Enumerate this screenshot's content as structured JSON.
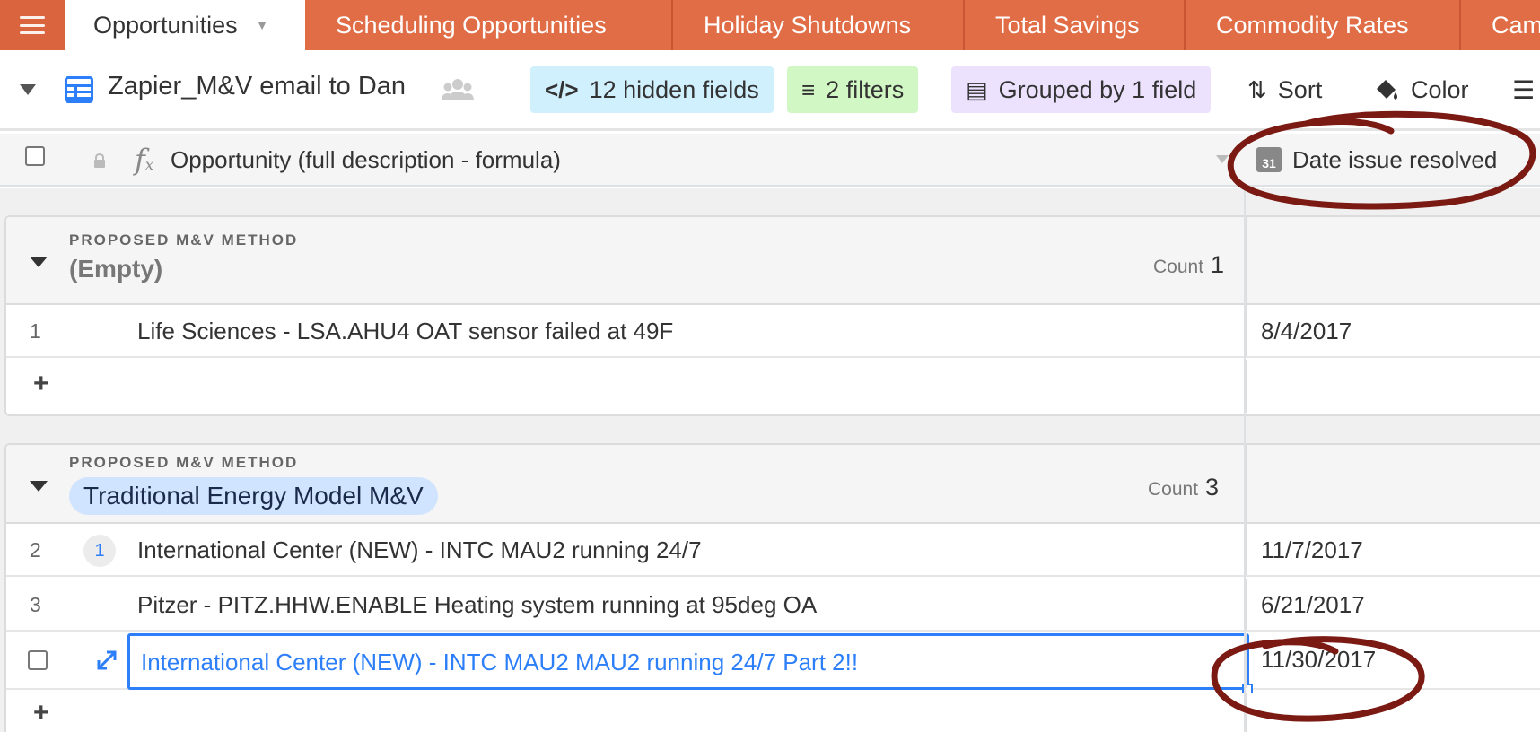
{
  "tabs": [
    {
      "label": "Opportunities",
      "active": true
    },
    {
      "label": "Scheduling Opportunities"
    },
    {
      "label": "Holiday Shutdowns"
    },
    {
      "label": "Total Savings"
    },
    {
      "label": "Commodity Rates"
    },
    {
      "label": "Cam"
    }
  ],
  "view": {
    "name": "Zapier_M&V email to Dan",
    "hidden_fields": "12 hidden fields",
    "filters": "2 filters",
    "grouped": "Grouped by 1 field",
    "sort": "Sort",
    "color": "Color"
  },
  "columns": {
    "primary": "Opportunity (full description - formula)",
    "date": "Date issue resolved"
  },
  "groups": [
    {
      "field": "PROPOSED M&V METHOD",
      "value": "(Empty)",
      "count_label": "Count",
      "count": "1",
      "rows": [
        {
          "num": "1",
          "text": "Life Sciences - LSA.AHU4 OAT sensor failed at 49F",
          "date": "8/4/2017"
        }
      ]
    },
    {
      "field": "PROPOSED M&V METHOD",
      "value": "Traditional Energy Model M&V",
      "count_label": "Count",
      "count": "3",
      "rows": [
        {
          "num": "2",
          "comments": "1",
          "text": "International Center (NEW) - INTC MAU2 running 24/7",
          "date": "11/7/2017"
        },
        {
          "num": "3",
          "text": "Pitzer - PITZ.HHW.ENABLE Heating system running at 95deg OA",
          "date": "6/21/2017"
        },
        {
          "text": "International Center (NEW) - INTC MAU2 MAU2 running 24/7 Part 2!!",
          "date": "11/30/2017",
          "selected": true
        }
      ]
    }
  ],
  "add_row": "+",
  "colors": {
    "tabbar": "#d9643e",
    "hidden_pill": "#d0f0fd",
    "filter_pill": "#d1f7c4",
    "group_pill": "#ede2fe",
    "accent": "#2d7ff9",
    "annotation": "#7a1a12"
  }
}
